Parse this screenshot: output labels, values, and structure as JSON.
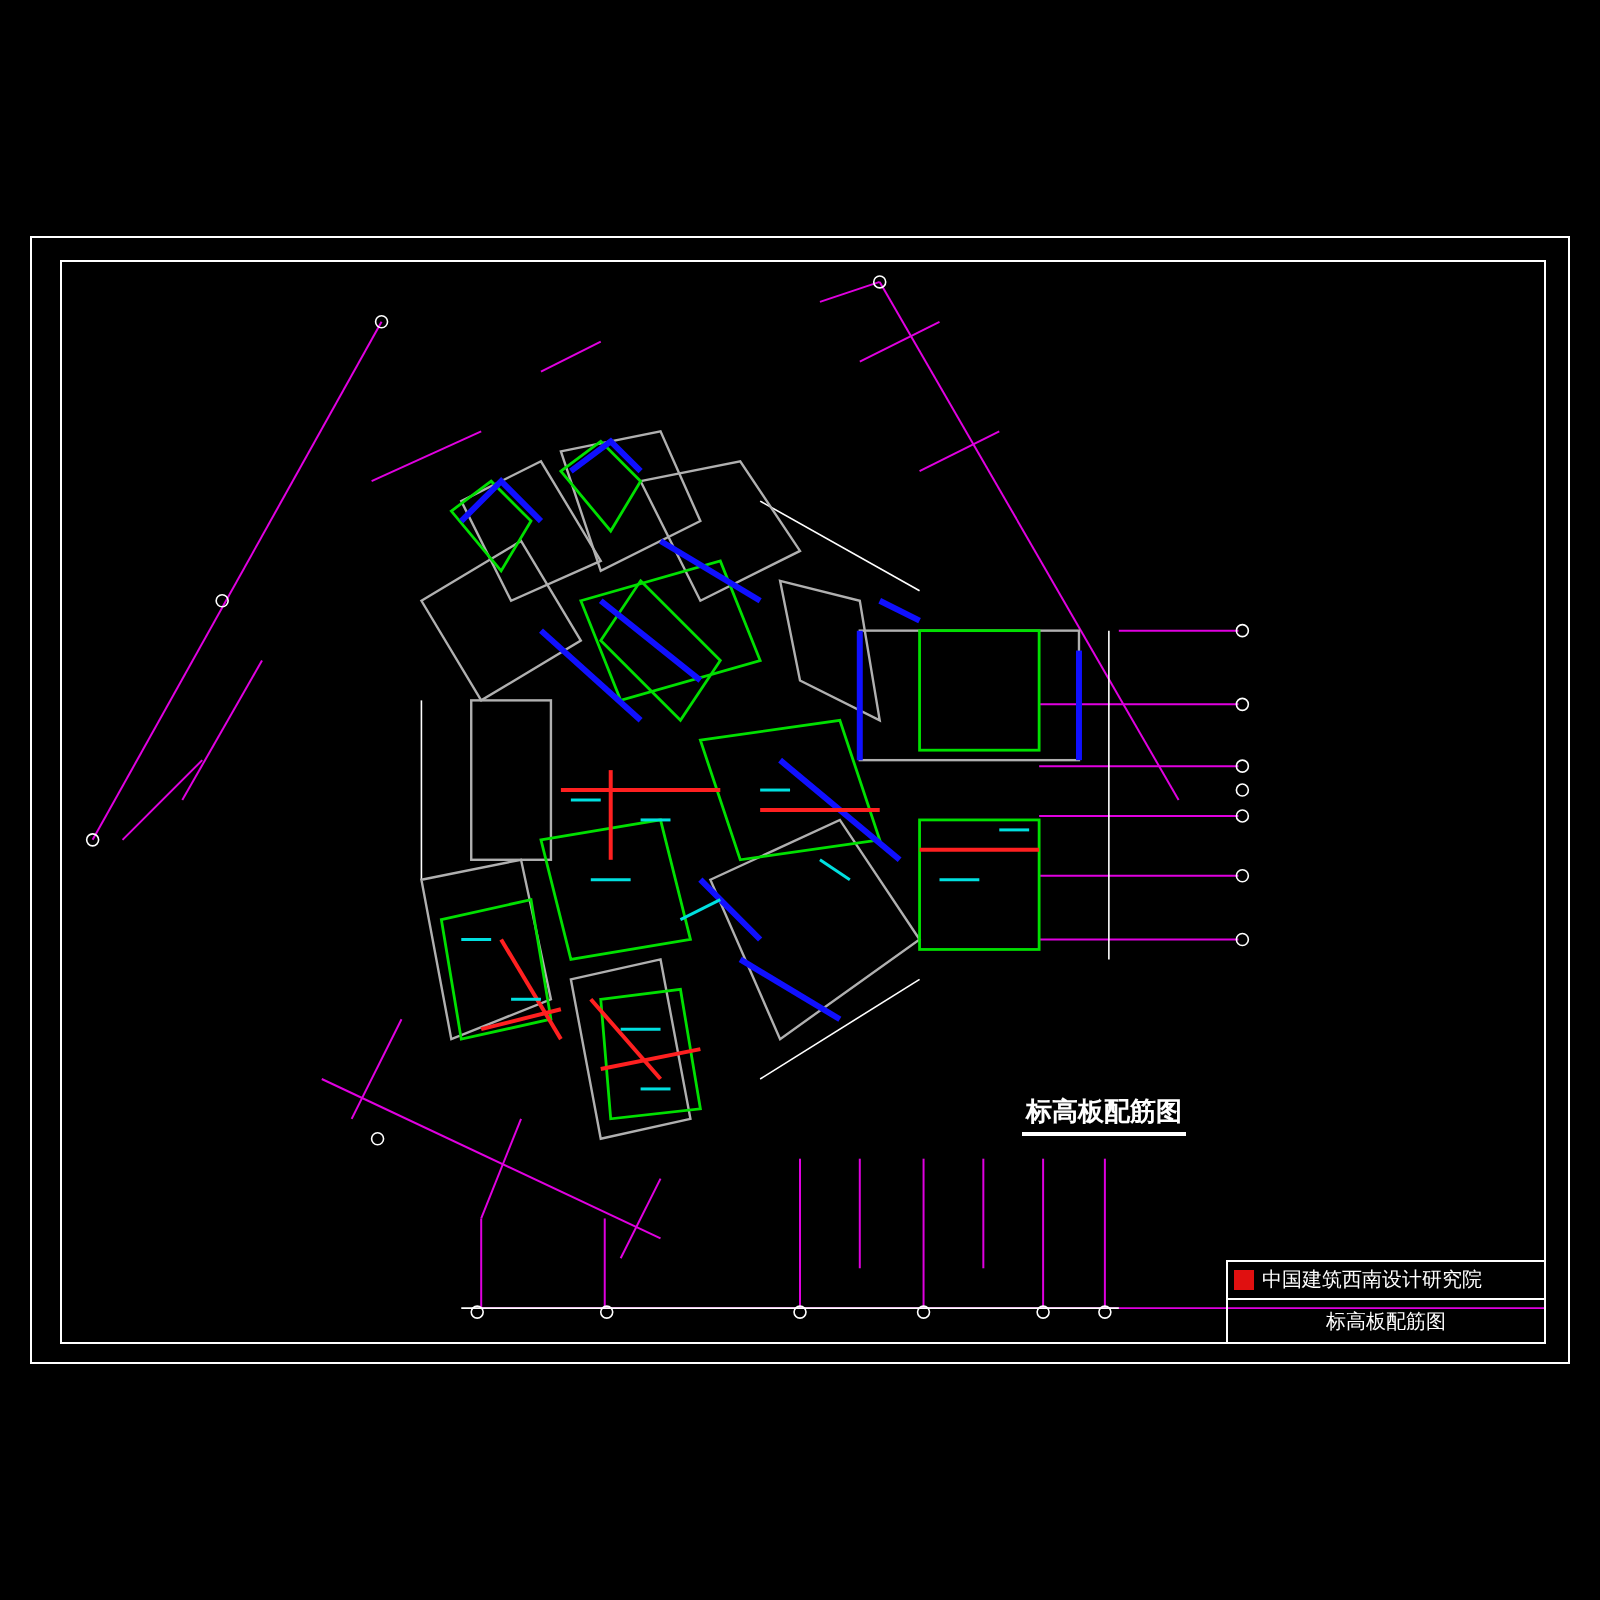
{
  "drawing": {
    "title": "标高板配筋图"
  },
  "title_block": {
    "company": "中国建筑西南设计研究院",
    "sheet_title": "标高板配筋图"
  }
}
